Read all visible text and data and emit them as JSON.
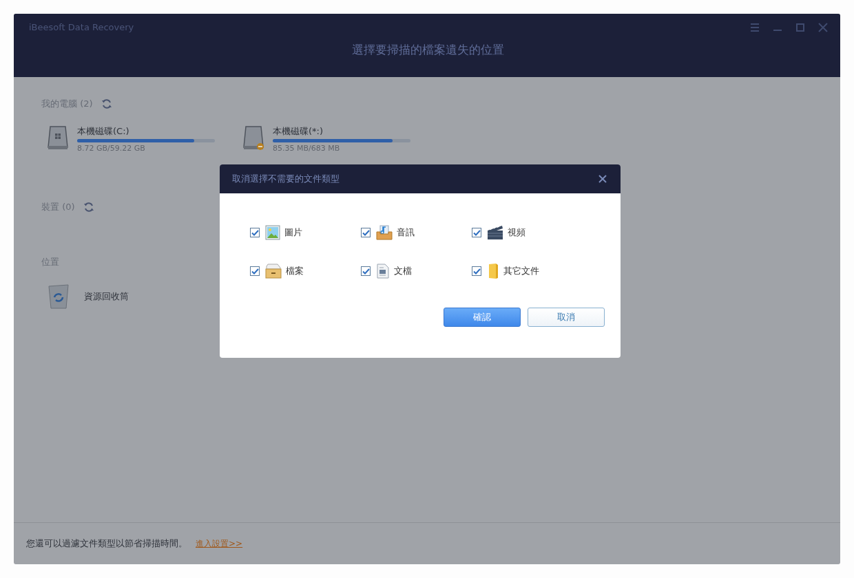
{
  "window": {
    "app_name": "iBeesoft Data Recovery",
    "heading": "選擇要掃描的檔案遺失的位置"
  },
  "sections": [
    {
      "title": "我的電腦 (2)",
      "refresh": true,
      "drives": [
        {
          "name": "本機磁碟(C:)",
          "size": "8.72 GB/59.22 GB",
          "level": 0.85,
          "kind": "system"
        },
        {
          "name": "本機磁碟(*:)",
          "size": "85.35 MB/683 MB",
          "level": 0.87,
          "kind": "other"
        }
      ]
    },
    {
      "title": "裝置 (0)",
      "refresh": true
    },
    {
      "title": "位置",
      "refresh": false,
      "locations": [
        {
          "name": "資源回收筒",
          "kind": "recycle"
        }
      ]
    }
  ],
  "dialog": {
    "title": "取消選擇不需要的文件類型",
    "types": [
      {
        "label": "圖片",
        "checked": true,
        "kind": "image"
      },
      {
        "label": "音訊",
        "checked": true,
        "kind": "audio"
      },
      {
        "label": "視頻",
        "checked": true,
        "kind": "video"
      },
      {
        "label": "檔案",
        "checked": true,
        "kind": "archive"
      },
      {
        "label": "文檔",
        "checked": true,
        "kind": "document"
      },
      {
        "label": "其它文件",
        "checked": true,
        "kind": "other"
      }
    ],
    "buttons": [
      {
        "label": "確認",
        "kind": "primary"
      },
      {
        "label": "取消",
        "kind": "secondary"
      }
    ]
  },
  "footer": {
    "hint": "您還可以過濾文件類型以節省掃描時間。",
    "link": "進入設置>>"
  }
}
